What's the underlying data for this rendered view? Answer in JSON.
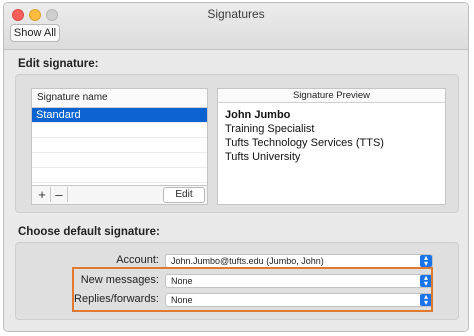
{
  "window": {
    "title": "Signatures"
  },
  "toolbar": {
    "show_all": "Show All"
  },
  "edit_signature": {
    "heading": "Edit signature:",
    "list_header": "Signature name",
    "items": [
      "Standard"
    ],
    "add": "+",
    "remove": "–",
    "edit_label": "Edit"
  },
  "preview": {
    "header": "Signature Preview",
    "lines": [
      "John Jumbo",
      "Training Specialist",
      "Tufts Technology Services (TTS)",
      "Tufts University"
    ]
  },
  "default_signature": {
    "heading": "Choose default signature:",
    "account_label": "Account:",
    "account_value": "John.Jumbo@tufts.edu (Jumbo, John)",
    "new_messages_label": "New messages:",
    "new_messages_value": "None",
    "replies_label": "Replies/forwards:",
    "replies_value": "None"
  },
  "colors": {
    "selection": "#0a63d0",
    "highlight_box": "#e07a2e",
    "accent": "#1a73e8"
  },
  "icons": [
    "close-light",
    "minimize-light",
    "zoom-light",
    "chevron-updown-icon"
  ]
}
